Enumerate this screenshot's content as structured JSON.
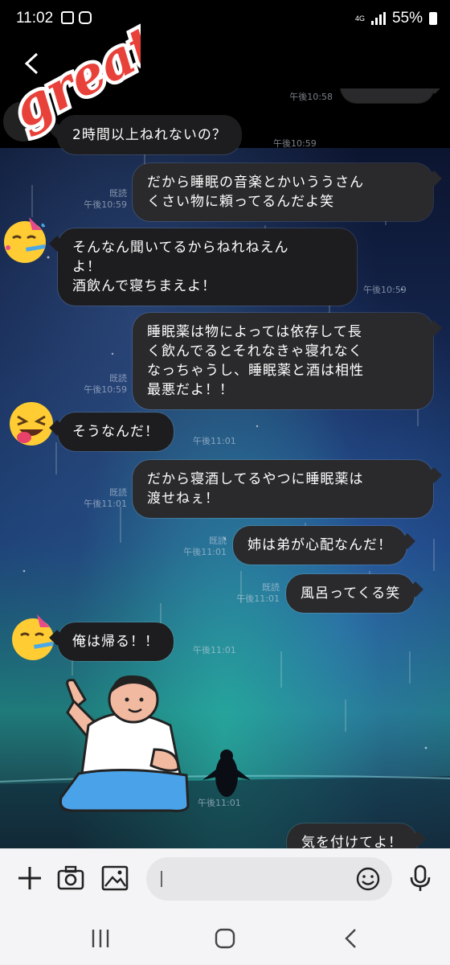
{
  "status": {
    "time": "11:02",
    "network": "4G",
    "battery": "55%"
  },
  "header": {
    "sticker_text": "great!"
  },
  "messages": [
    {
      "id": "m1",
      "dir": "in",
      "text": "2時間以上ねれないの？",
      "time": "午後10:59"
    },
    {
      "id": "m2",
      "dir": "out",
      "text": "だから睡眠の音楽とかいううさん\nくさい物に頼ってるんだよ笑",
      "read": "既読",
      "time": "午後10:59"
    },
    {
      "id": "m3",
      "dir": "in",
      "text": "そんなん聞いてるからねれねえん\nよ！\n酒飲んで寝ちまえよ！",
      "time": "午後10:59"
    },
    {
      "id": "m4",
      "dir": "out",
      "text": "睡眠薬は物によっては依存して長\nく飲んでるとそれなきゃ寝れなく\nなっちゃうし、睡眠薬と酒は相性\n最悪だよ！！",
      "read": "既読",
      "time": "午後10:59"
    },
    {
      "id": "m5",
      "dir": "in",
      "text": "そうなんだ！",
      "time": "午後11:01"
    },
    {
      "id": "m6",
      "dir": "out",
      "text": "だから寝酒してるやつに睡眠薬は\n渡せねぇ！",
      "read": "既読",
      "time": "午後11:01"
    },
    {
      "id": "m7",
      "dir": "out",
      "text": "姉は弟が心配なんだ！",
      "read": "既読",
      "time": "午後11:01"
    },
    {
      "id": "m8",
      "dir": "out",
      "text": "風呂ってくる笑",
      "read": "既読",
      "time": "午後11:01"
    },
    {
      "id": "m9",
      "dir": "in",
      "text": "俺は帰る！！",
      "time": "午後11:01"
    },
    {
      "id": "m10",
      "dir": "in",
      "sticker": "waving-man",
      "time": "午後11:01"
    },
    {
      "id": "m11",
      "dir": "out",
      "text": "気を付けてよ！"
    }
  ],
  "previous_time": "午後10:58",
  "input": {
    "placeholder": ""
  },
  "colors": {
    "bubble": "#1d1d1f",
    "chat_bg": "#14254d",
    "accent": "#ffcc33"
  }
}
